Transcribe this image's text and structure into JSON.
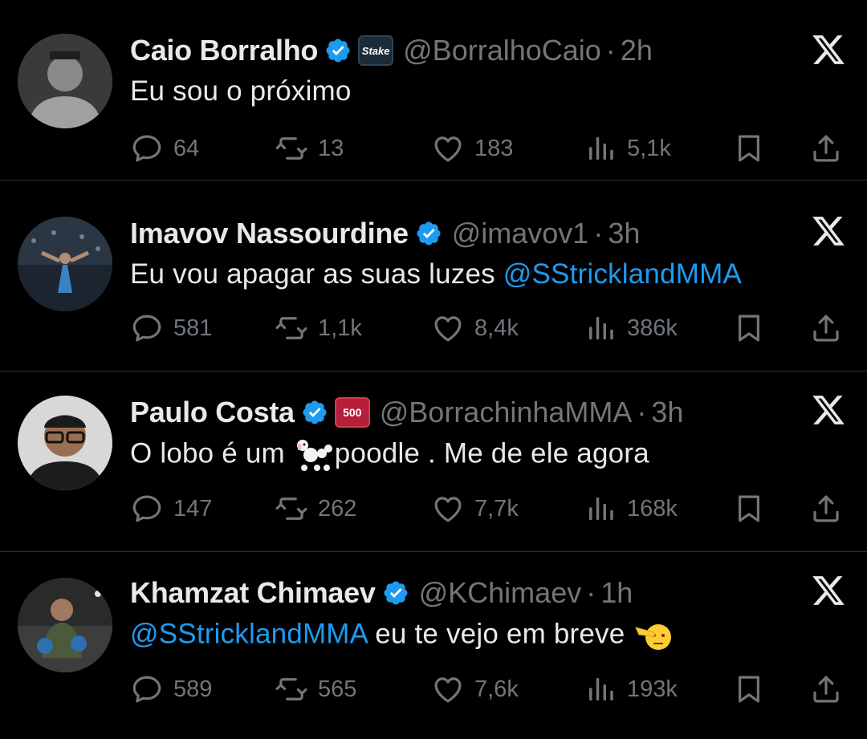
{
  "tweets": [
    {
      "name": "Caio Borralho",
      "affiliate": "Stake",
      "handle": "@BorralhoCaio",
      "time": "2h",
      "text_parts": [
        "Eu sou o próximo"
      ],
      "replies": "64",
      "retweets": "13",
      "likes": "183",
      "views": "5,1k"
    },
    {
      "name": "Imavov Nassourdine",
      "handle": "@imavov1",
      "time": "3h",
      "text_parts": [
        "Eu vou apagar as suas luzes ",
        "@SStricklandMMA"
      ],
      "replies": "581",
      "retweets": "1,1k",
      "likes": "8,4k",
      "views": "386k"
    },
    {
      "name": "Paulo Costa",
      "affiliate": "500",
      "handle": "@BorrachinhaMMA",
      "time": "3h",
      "text_parts": [
        "O lobo é um ",
        "poodle . Me de ele agora"
      ],
      "emoji": "poodle-emoji",
      "replies": "147",
      "retweets": "262",
      "likes": "7,7k",
      "views": "168k"
    },
    {
      "name": "Khamzat Chimaev",
      "handle": "@KChimaev",
      "time": "1h",
      "text_parts": [
        "@SStricklandMMA",
        " eu te vejo em breve "
      ],
      "emoji": "saluting-face-emoji",
      "replies": "589",
      "retweets": "565",
      "likes": "7,6k",
      "views": "193k"
    }
  ],
  "separator": "·",
  "colors": {
    "background": "#000000",
    "text": "#e7e9ea",
    "muted": "#71767b",
    "link": "#1d9bf0",
    "verified": "#1d9bf0",
    "divider": "#2f3336"
  },
  "icons": [
    "reply-icon",
    "retweet-icon",
    "like-icon",
    "views-icon",
    "bookmark-icon",
    "share-icon",
    "verified-badge-icon",
    "x-logo-icon"
  ]
}
